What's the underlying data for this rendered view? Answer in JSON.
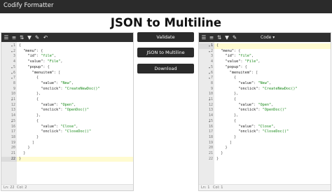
{
  "app": {
    "title": "Codify Formatter"
  },
  "page": {
    "heading": "JSON to Multiline"
  },
  "actions": {
    "validate": "Validate",
    "convert": "JSON to Multiline",
    "download": "Download"
  },
  "left_panel": {
    "toolbar_icons": [
      "format-icon",
      "compact-icon",
      "sort-icon",
      "filter-icon",
      "repair-icon",
      "undo-icon"
    ],
    "lines": [
      {
        "n": "1",
        "t": "{"
      },
      {
        "n": "2",
        "t": "  \"menu\": {"
      },
      {
        "n": "3",
        "t": "    \"id\": \"file\","
      },
      {
        "n": "4",
        "t": "    \"value\": \"File\","
      },
      {
        "n": "5",
        "t": "    \"popup\": {"
      },
      {
        "n": "6",
        "t": "      \"menuitem\": ["
      },
      {
        "n": "7",
        "t": "        {"
      },
      {
        "n": "8",
        "t": "          \"value\": \"New\","
      },
      {
        "n": "9",
        "t": "          \"onclick\": \"CreateNewDoc()\""
      },
      {
        "n": "10",
        "t": "        },"
      },
      {
        "n": "11",
        "t": "        {"
      },
      {
        "n": "12",
        "t": "          \"value\": \"Open\","
      },
      {
        "n": "13",
        "t": "          \"onclick\": \"OpenDoc()\""
      },
      {
        "n": "14",
        "t": "        },"
      },
      {
        "n": "15",
        "t": "        {"
      },
      {
        "n": "16",
        "t": "          \"value\": \"Close\","
      },
      {
        "n": "17",
        "t": "          \"onclick\": \"CloseDoc()\""
      },
      {
        "n": "18",
        "t": "        }"
      },
      {
        "n": "19",
        "t": "      ]"
      },
      {
        "n": "20",
        "t": "    }"
      },
      {
        "n": "21",
        "t": "  }"
      },
      {
        "n": "22",
        "t": "}"
      }
    ],
    "active_line": 22,
    "status": {
      "ln": "Ln: 22",
      "col": "Col: 2"
    }
  },
  "right_panel": {
    "toolbar_icons": [
      "format-icon",
      "compact-icon",
      "sort-icon",
      "filter-icon",
      "repair-icon"
    ],
    "mode": "Code ▾",
    "lines": [
      {
        "n": "1",
        "t": "{"
      },
      {
        "n": "2",
        "t": "  \"menu\": {"
      },
      {
        "n": "3",
        "t": "    \"id\": \"file\","
      },
      {
        "n": "4",
        "t": "    \"value\": \"File\","
      },
      {
        "n": "5",
        "t": "    \"popup\": {"
      },
      {
        "n": "6",
        "t": "      \"menuitem\": ["
      },
      {
        "n": "7",
        "t": "        {"
      },
      {
        "n": "8",
        "t": "          \"value\": \"New\","
      },
      {
        "n": "9",
        "t": "          \"onclick\": \"CreateNewDoc()\""
      },
      {
        "n": "10",
        "t": "        },"
      },
      {
        "n": "11",
        "t": "        {"
      },
      {
        "n": "12",
        "t": "          \"value\": \"Open\","
      },
      {
        "n": "13",
        "t": "          \"onclick\": \"OpenDoc()\""
      },
      {
        "n": "14",
        "t": "        },"
      },
      {
        "n": "15",
        "t": "        {"
      },
      {
        "n": "16",
        "t": "          \"value\": \"Close\","
      },
      {
        "n": "17",
        "t": "          \"onclick\": \"CloseDoc()\""
      },
      {
        "n": "18",
        "t": "        }"
      },
      {
        "n": "19",
        "t": "      ]"
      },
      {
        "n": "20",
        "t": "    }"
      },
      {
        "n": "21",
        "t": "  }"
      },
      {
        "n": "22",
        "t": "}"
      }
    ],
    "active_line": 1,
    "status": {
      "ln": "Ln: 1",
      "col": "Col: 1"
    }
  },
  "colors": {
    "toolbar": "#2f2f2f",
    "button": "#2b2b2b",
    "string": "#1a8a1a",
    "active_line": "#fffbd0"
  }
}
